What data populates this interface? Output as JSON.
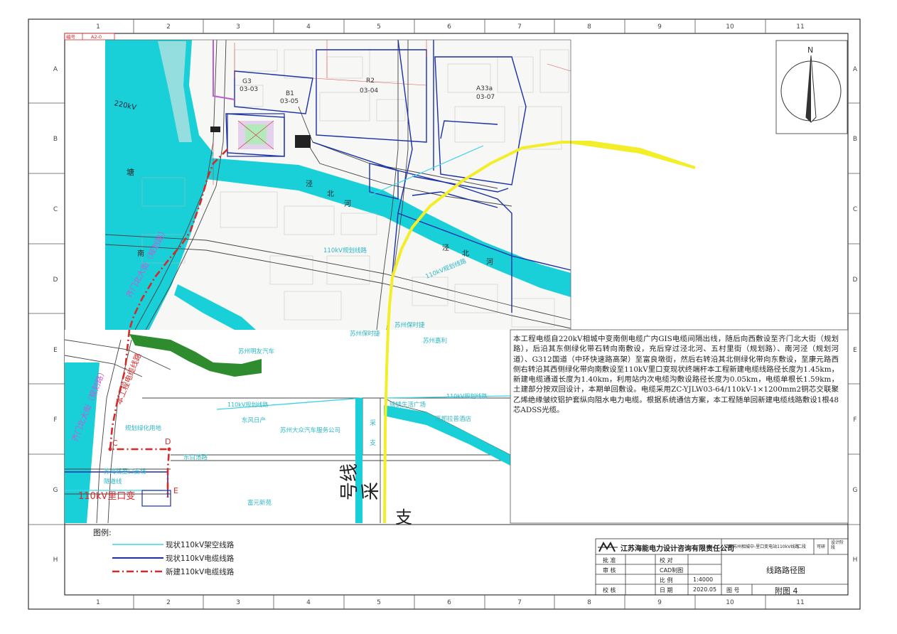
{
  "sheet": {
    "top_tags": [
      "编号",
      "A2-0"
    ],
    "col_numbers": [
      "1",
      "2",
      "3",
      "4",
      "5",
      "6",
      "7",
      "8",
      "9",
      "10",
      "11"
    ],
    "row_letters": [
      "A",
      "B",
      "C",
      "D",
      "E",
      "F",
      "G",
      "H"
    ]
  },
  "map": {
    "blocks": [
      {
        "code": "G3",
        "sub": "03-03"
      },
      {
        "code": "B1",
        "sub": "03-05"
      },
      {
        "code": "R2",
        "sub": "03-04"
      },
      {
        "code": "A33a",
        "sub": "03-07"
      }
    ],
    "voltage_label": "220kV",
    "place_tang": "塘",
    "river_jingbei": [
      "泾",
      "北",
      "河"
    ],
    "river_jingbei_2": [
      "泾",
      "北",
      "河"
    ],
    "road_nan": "南",
    "road_wucunli": "五村里街",
    "road_qimen_planned": "齐门北大街（规划路）",
    "road_qimen_planned_lower": "齐门北大街（规划路）",
    "cable_note": "本工程电缆线路",
    "cable_existing_label": "110kV规划线路",
    "cable_existing_label_2": "110kV规划线路",
    "company_mingyou": "苏州明友汽车",
    "company_baoshijie": "苏州保时捷",
    "company_jiali": "苏州嘉利",
    "company_dongfeng": "东风日产",
    "company_dazhong": "苏州大众汽车服务公司",
    "company_yongheng": "锦锈生活广场",
    "company_baifen": "百邦拉普酒店",
    "place_parking": "规划绿化用地",
    "road_bailong": "东白荡路",
    "place_fuyuan": "富元新苑",
    "cable_liko_line": "苏湾线里口支线",
    "cable_liko_line_2": "隧道线",
    "substation": "110kV里口变",
    "point_c": "C",
    "point_d": "D",
    "point_e": "E",
    "road_big_hao": "号线",
    "road_big_cai": "采",
    "road_big_zhi": "支",
    "road_small_cai": "采",
    "road_small_zhi": "支"
  },
  "description": "本工程电缆自220kV相城中变南侧电缆广内GIS电缆间隔出线，随后向西敷设至齐门北大街（规划路），后沿其东侧绿化带石转向南敷设，充后穿过泾北河、五村里街（规划路）、南河泾（规划河道）、G312国道（中环快速路高架）至富良墩街，然后右转沿其北侧绿化带向东敷设，至康元路西侧右转沿其西侧绿化带向南敷设至110kV里口变现状终端杆本工程新建电缆线路径长度为1.45km，新建电缆通道长度为1.40km，利用站内次电缆沟敷设路径长度为0.05km，电缆单根长1.59km，土建部分按双回设计，本期单回敷设。电缆采用ZC-YJLW03-64/110kV-1×1200mm2铜芯交联聚乙烯绝缘皱纹铝护套纵向阻水电力电缆。根据系统通信方案，本工程随单回新建电缆线路敷设1根48芯ADSS光缆。",
  "legend": {
    "title": "图例:",
    "items": [
      {
        "label": "现状110kV架空线路",
        "color": "#3fd3e8"
      },
      {
        "label": "现状110kV电缆线路",
        "color": "#1a2fa8"
      },
      {
        "label": "新建110kV电缆线路",
        "color": "#d42a2a"
      }
    ]
  },
  "compass": {
    "north": "N"
  },
  "title_block": {
    "company": "江苏海能电力设计咨询有限责任公司",
    "project": "江苏苏州相城中-里口变电站110kV线路",
    "stage": "二段",
    "design_stage": "可研",
    "design_label": "设计阶段",
    "rows": [
      {
        "k1": "批  准",
        "k2": "校  对",
        "v2": ""
      },
      {
        "k1": "审  核",
        "k2": "CAD制图",
        "v2": ""
      },
      {
        "k1": "",
        "k2": "比  例",
        "v2": "1:4000"
      },
      {
        "k1": "校  核",
        "k2": "日  期",
        "v2": "2020.05"
      }
    ],
    "drawing_title": "线路路径图",
    "drawing_no_label": "图  号",
    "drawing_no": "附图 4"
  },
  "colors": {
    "water": "#1ad0d8",
    "road_yellow": "#f2ee28",
    "existing_cable": "#1a2fa8",
    "new_cable": "#d42a2a",
    "overhead": "#3fd3e8",
    "planned": "#c05bd6",
    "green": "#2e8b2e"
  }
}
